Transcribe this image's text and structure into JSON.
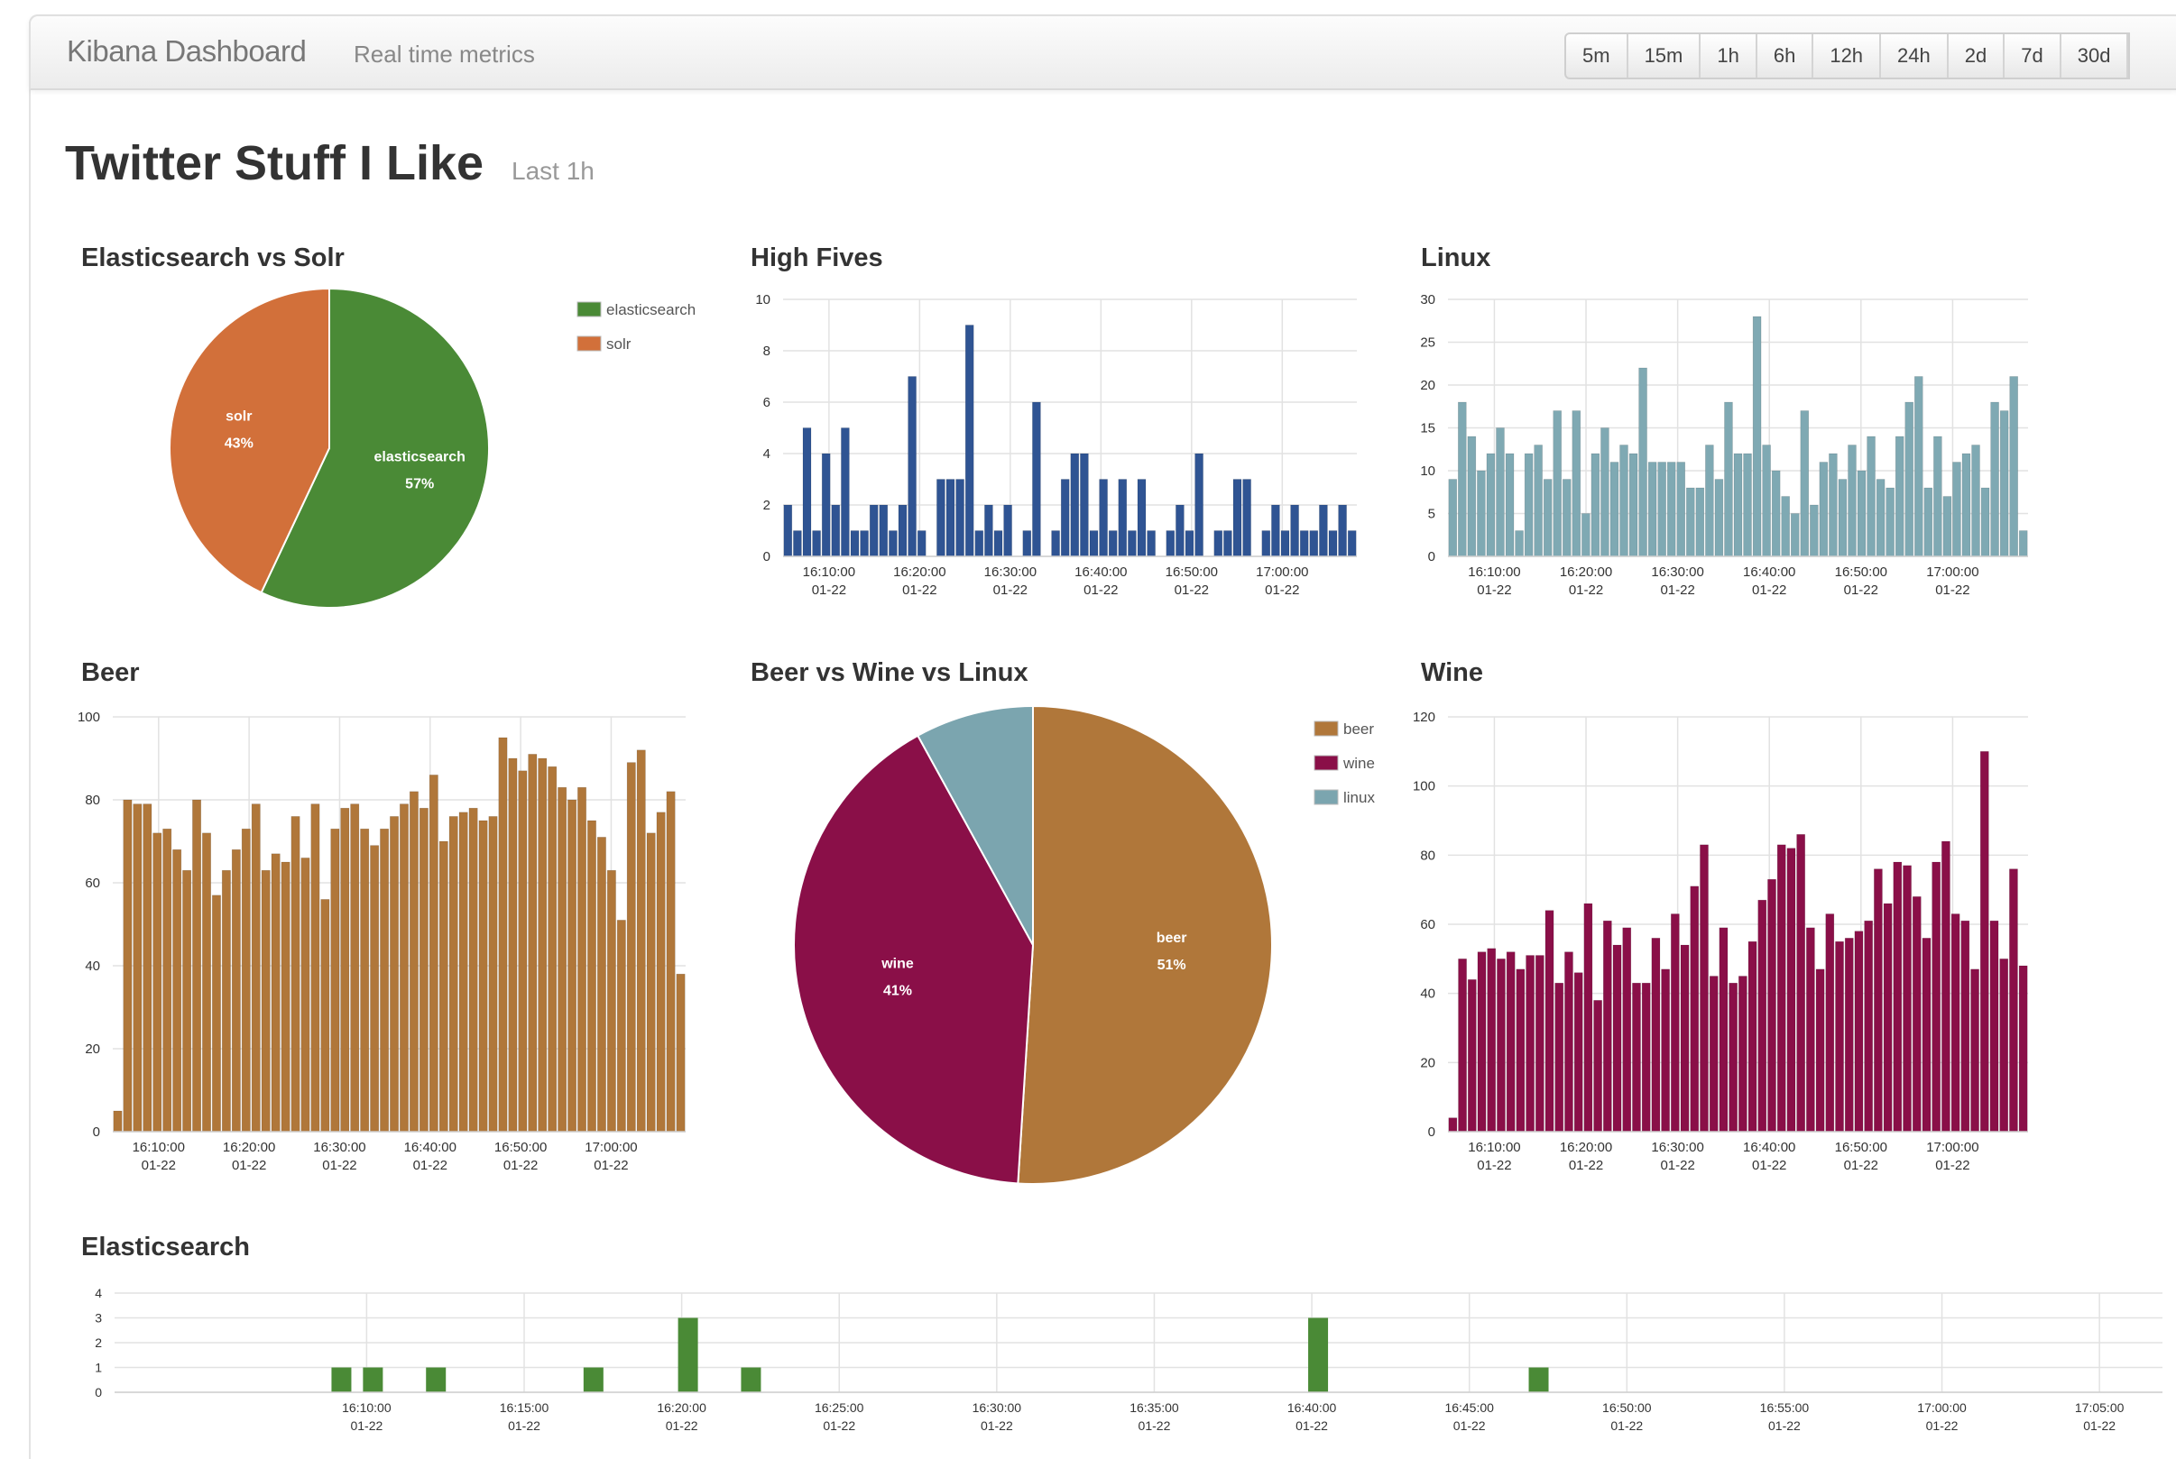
{
  "header": {
    "brand": "Kibana Dashboard",
    "subtitle": "Real time metrics",
    "time_options": [
      "5m",
      "15m",
      "1h",
      "6h",
      "12h",
      "24h",
      "2d",
      "7d",
      "30d"
    ]
  },
  "page": {
    "title": "Twitter Stuff I Like",
    "range_label": "Last 1h"
  },
  "colors": {
    "green": "#4a8a36",
    "orange": "#d2703a",
    "blue": "#2f5493",
    "teal": "#7fa9b3",
    "tan": "#b0773a",
    "maroon": "#8a0f48",
    "grey_blue": "#7ba5af"
  },
  "panels": {
    "es_vs_solr": {
      "title": "Elasticsearch vs Solr"
    },
    "high_fives": {
      "title": "High Fives"
    },
    "linux": {
      "title": "Linux"
    },
    "beer": {
      "title": "Beer"
    },
    "bwl": {
      "title": "Beer vs Wine vs Linux"
    },
    "wine": {
      "title": "Wine"
    },
    "elasticsearch": {
      "title": "Elasticsearch"
    }
  },
  "chart_data": [
    {
      "id": "es_vs_solr",
      "type": "pie",
      "legend": [
        "elasticsearch",
        "solr"
      ],
      "labels": [
        "elasticsearch",
        "solr"
      ],
      "values": [
        57,
        43
      ],
      "slice_labels": [
        "57%",
        "43%"
      ],
      "colors": [
        "#4a8a36",
        "#d2703a"
      ],
      "legend_position": "top-right"
    },
    {
      "id": "high_fives",
      "type": "bar",
      "ylim": [
        0,
        10
      ],
      "yticks": [
        "0",
        "2",
        "4",
        "6",
        "8",
        "10"
      ],
      "xticks": [
        {
          "time": "16:10:00",
          "date": "01-22"
        },
        {
          "time": "16:20:00",
          "date": "01-22"
        },
        {
          "time": "16:30:00",
          "date": "01-22"
        },
        {
          "time": "16:40:00",
          "date": "01-22"
        },
        {
          "time": "16:50:00",
          "date": "01-22"
        },
        {
          "time": "17:00:00",
          "date": "01-22"
        }
      ],
      "x_minutes_range": [
        16.05,
        17.1
      ],
      "color": "#2f5493",
      "values": [
        2,
        1,
        5,
        1,
        4,
        2,
        5,
        1,
        1,
        2,
        2,
        1,
        2,
        7,
        1,
        0,
        3,
        3,
        3,
        9,
        1,
        2,
        1,
        2,
        0,
        1,
        6,
        0,
        1,
        3,
        4,
        4,
        1,
        3,
        1,
        3,
        1,
        3,
        1,
        0,
        1,
        2,
        1,
        4,
        0,
        1,
        1,
        3,
        3,
        0,
        1,
        2,
        1,
        2,
        1,
        1,
        2,
        1,
        2,
        1
      ]
    },
    {
      "id": "linux",
      "type": "bar",
      "ylim": [
        0,
        30
      ],
      "yticks": [
        "0",
        "5",
        "10",
        "15",
        "20",
        "25",
        "30"
      ],
      "xticks": [
        {
          "time": "16:10:00",
          "date": "01-22"
        },
        {
          "time": "16:20:00",
          "date": "01-22"
        },
        {
          "time": "16:30:00",
          "date": "01-22"
        },
        {
          "time": "16:40:00",
          "date": "01-22"
        },
        {
          "time": "16:50:00",
          "date": "01-22"
        },
        {
          "time": "17:00:00",
          "date": "01-22"
        }
      ],
      "color": "#7fa9b3",
      "values": [
        9,
        18,
        14,
        10,
        12,
        15,
        12,
        3,
        12,
        13,
        9,
        17,
        9,
        17,
        5,
        12,
        15,
        11,
        13,
        12,
        22,
        11,
        11,
        11,
        11,
        8,
        8,
        13,
        9,
        18,
        12,
        12,
        28,
        13,
        10,
        7,
        5,
        17,
        6,
        11,
        12,
        9,
        13,
        10,
        14,
        9,
        8,
        14,
        18,
        21,
        8,
        14,
        7,
        11,
        12,
        13,
        8,
        18,
        17,
        21,
        3
      ]
    },
    {
      "id": "beer",
      "type": "bar",
      "ylim": [
        0,
        100
      ],
      "yticks": [
        "0",
        "20",
        "40",
        "60",
        "80",
        "100"
      ],
      "xticks": [
        {
          "time": "16:10:00",
          "date": "01-22"
        },
        {
          "time": "16:20:00",
          "date": "01-22"
        },
        {
          "time": "16:30:00",
          "date": "01-22"
        },
        {
          "time": "16:40:00",
          "date": "01-22"
        },
        {
          "time": "16:50:00",
          "date": "01-22"
        },
        {
          "time": "17:00:00",
          "date": "01-22"
        }
      ],
      "color": "#b0773a",
      "values": [
        5,
        80,
        79,
        79,
        72,
        73,
        68,
        63,
        80,
        72,
        57,
        63,
        68,
        73,
        79,
        63,
        67,
        65,
        76,
        66,
        79,
        56,
        73,
        78,
        79,
        73,
        69,
        73,
        76,
        79,
        82,
        78,
        86,
        70,
        76,
        77,
        78,
        75,
        76,
        95,
        90,
        87,
        91,
        90,
        88,
        83,
        80,
        83,
        75,
        71,
        63,
        51,
        89,
        92,
        72,
        77,
        82,
        38
      ]
    },
    {
      "id": "bwl",
      "type": "pie",
      "legend": [
        "beer",
        "wine",
        "linux"
      ],
      "labels": [
        "beer",
        "wine",
        "linux"
      ],
      "values": [
        51,
        41,
        8
      ],
      "slice_labels": [
        "51%",
        "41%",
        ""
      ],
      "colors": [
        "#b0773a",
        "#8a0f48",
        "#7ba5af"
      ],
      "legend_position": "top-right"
    },
    {
      "id": "wine",
      "type": "bar",
      "ylim": [
        0,
        120
      ],
      "yticks": [
        "0",
        "20",
        "40",
        "60",
        "80",
        "100",
        "120"
      ],
      "xticks": [
        {
          "time": "16:10:00",
          "date": "01-22"
        },
        {
          "time": "16:20:00",
          "date": "01-22"
        },
        {
          "time": "16:30:00",
          "date": "01-22"
        },
        {
          "time": "16:40:00",
          "date": "01-22"
        },
        {
          "time": "16:50:00",
          "date": "01-22"
        },
        {
          "time": "17:00:00",
          "date": "01-22"
        }
      ],
      "color": "#8a0f48",
      "values": [
        4,
        50,
        44,
        52,
        53,
        50,
        52,
        47,
        51,
        51,
        64,
        43,
        52,
        46,
        66,
        38,
        61,
        54,
        59,
        43,
        43,
        56,
        47,
        63,
        54,
        71,
        83,
        45,
        59,
        43,
        45,
        55,
        67,
        73,
        83,
        82,
        86,
        59,
        47,
        63,
        55,
        56,
        58,
        61,
        76,
        66,
        78,
        77,
        68,
        56,
        78,
        84,
        63,
        61,
        47,
        110,
        61,
        50,
        76,
        48
      ]
    },
    {
      "id": "elasticsearch",
      "type": "bar",
      "ylim": [
        0,
        4
      ],
      "yticks": [
        "0",
        "1",
        "2",
        "3",
        "4"
      ],
      "xticks": [
        {
          "time": "16:10:00",
          "date": "01-22"
        },
        {
          "time": "16:15:00",
          "date": "01-22"
        },
        {
          "time": "16:20:00",
          "date": "01-22"
        },
        {
          "time": "16:25:00",
          "date": "01-22"
        },
        {
          "time": "16:30:00",
          "date": "01-22"
        },
        {
          "time": "16:35:00",
          "date": "01-22"
        },
        {
          "time": "16:40:00",
          "date": "01-22"
        },
        {
          "time": "16:45:00",
          "date": "01-22"
        },
        {
          "time": "16:50:00",
          "date": "01-22"
        },
        {
          "time": "16:55:00",
          "date": "01-22"
        },
        {
          "time": "17:00:00",
          "date": "01-22"
        },
        {
          "time": "17:05:00",
          "date": "01-22"
        }
      ],
      "color": "#4a8a36",
      "points": [
        {
          "minute": 9.2,
          "value": 1
        },
        {
          "minute": 10.2,
          "value": 1
        },
        {
          "minute": 12.2,
          "value": 1
        },
        {
          "minute": 17.2,
          "value": 1
        },
        {
          "minute": 20.2,
          "value": 3
        },
        {
          "minute": 22.2,
          "value": 1
        },
        {
          "minute": 40.2,
          "value": 3
        },
        {
          "minute": 47.2,
          "value": 1
        }
      ]
    }
  ]
}
